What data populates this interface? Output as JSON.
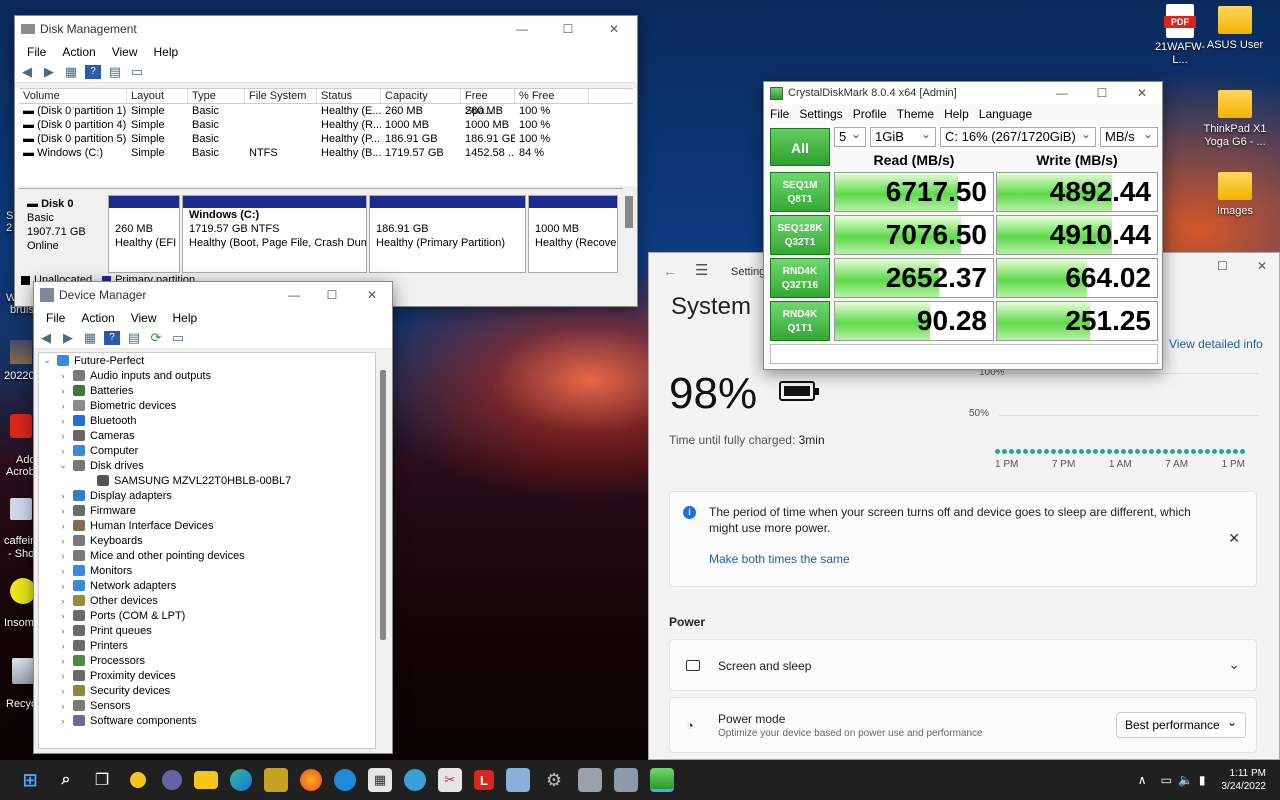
{
  "desktop": {
    "icons_right": [
      {
        "label": "21WAFW-L...",
        "icon": "pdf-icon"
      },
      {
        "label": "ASUS User",
        "icon": "folder-icon"
      },
      {
        "label": "ThinkPad X1 Yoga G6 - ...",
        "icon": "folder-icon"
      },
      {
        "label": "Images",
        "icon": "folder-icon"
      }
    ],
    "pdf_text": "PDF",
    "left_partial": [
      "S",
      "2",
      "W",
      "bruis",
      "20220",
      "Add",
      "Acrob",
      "caffein",
      "- Sho",
      "Insomn",
      "Recyc"
    ]
  },
  "disk_management": {
    "title": "Disk Management",
    "menu": [
      "File",
      "Action",
      "View",
      "Help"
    ],
    "columns": [
      "Volume",
      "Layout",
      "Type",
      "File System",
      "Status",
      "Capacity",
      "Free Spa...",
      "% Free"
    ],
    "rows": [
      [
        "(Disk 0 partition 1)",
        "Simple",
        "Basic",
        "",
        "Healthy (E...",
        "260 MB",
        "260 MB",
        "100 %"
      ],
      [
        "(Disk 0 partition 4)",
        "Simple",
        "Basic",
        "",
        "Healthy (R...",
        "1000 MB",
        "1000 MB",
        "100 %"
      ],
      [
        "(Disk 0 partition 5)",
        "Simple",
        "Basic",
        "",
        "Healthy (P...",
        "186.91 GB",
        "186.91 GB",
        "100 %"
      ],
      [
        "Windows (C:)",
        "Simple",
        "Basic",
        "NTFS",
        "Healthy (B...",
        "1719.57 GB",
        "1452.58 ...",
        "84 %"
      ]
    ],
    "disk": {
      "name": "Disk 0",
      "type": "Basic",
      "size": "1907.71 GB",
      "state": "Online"
    },
    "partitions": [
      {
        "name": "",
        "size": "260 MB",
        "status": "Healthy (EFI S"
      },
      {
        "name": "Windows  (C:)",
        "size": "1719.57 GB NTFS",
        "status": "Healthy (Boot, Page File, Crash Dump, B"
      },
      {
        "name": "",
        "size": "186.91 GB",
        "status": "Healthy (Primary Partition)"
      },
      {
        "name": "",
        "size": "1000 MB",
        "status": "Healthy (Recovery"
      }
    ],
    "legend": [
      "Unallocated",
      "Primary partition"
    ]
  },
  "device_manager": {
    "title": "Device Manager",
    "menu": [
      "File",
      "Action",
      "View",
      "Help"
    ],
    "root": "Future-Perfect",
    "items": [
      {
        "label": "Audio inputs and outputs",
        "color": "#7a7a7a"
      },
      {
        "label": "Batteries",
        "color": "#3a7a3a"
      },
      {
        "label": "Biometric devices",
        "color": "#8a8a8a"
      },
      {
        "label": "Bluetooth",
        "color": "#1e6fd9"
      },
      {
        "label": "Cameras",
        "color": "#666666"
      },
      {
        "label": "Computer",
        "color": "#3b8ad9"
      },
      {
        "label": "Disk drives",
        "color": "#777777",
        "expanded": true
      },
      {
        "label": "SAMSUNG MZVL22T0HBLB-00BL7",
        "color": "#555555",
        "child": true
      },
      {
        "label": "Display adapters",
        "color": "#2f7fc9"
      },
      {
        "label": "Firmware",
        "color": "#6a6a6a"
      },
      {
        "label": "Human Interface Devices",
        "color": "#8a6a4a"
      },
      {
        "label": "Keyboards",
        "color": "#7a7a7a"
      },
      {
        "label": "Mice and other pointing devices",
        "color": "#7a7a7a"
      },
      {
        "label": "Monitors",
        "color": "#3b8ad9"
      },
      {
        "label": "Network adapters",
        "color": "#3b8ad9"
      },
      {
        "label": "Other devices",
        "color": "#9a8a3a"
      },
      {
        "label": "Ports (COM & LPT)",
        "color": "#6a6a6a"
      },
      {
        "label": "Print queues",
        "color": "#6a6a6a"
      },
      {
        "label": "Printers",
        "color": "#6a6a6a"
      },
      {
        "label": "Processors",
        "color": "#4a8a4a"
      },
      {
        "label": "Proximity devices",
        "color": "#6a6a6a"
      },
      {
        "label": "Security devices",
        "color": "#8a8a3a"
      },
      {
        "label": "Sensors",
        "color": "#7a7a7a"
      },
      {
        "label": "Software components",
        "color": "#6a6a9a"
      }
    ]
  },
  "crystaldiskmark": {
    "title": "CrystalDiskMark 8.0.4 x64 [Admin]",
    "menu": [
      "File",
      "Settings",
      "Profile",
      "Theme",
      "Help",
      "Language"
    ],
    "count": "5",
    "size": "1GiB",
    "drive": "C: 16% (267/1720GiB)",
    "unit": "MB/s",
    "all_label": "All",
    "read_header": "Read (MB/s)",
    "write_header": "Write (MB/s)",
    "tests": [
      {
        "l1": "SEQ1M",
        "l2": "Q8T1",
        "read": "6717.50",
        "write": "4892.44",
        "read_fill": 0.78,
        "write_fill": 0.72
      },
      {
        "l1": "SEQ128K",
        "l2": "Q32T1",
        "read": "7076.50",
        "write": "4910.44",
        "read_fill": 0.8,
        "write_fill": 0.72
      },
      {
        "l1": "RND4K",
        "l2": "Q32T16",
        "read": "2652.37",
        "write": "664.02",
        "read_fill": 0.66,
        "write_fill": 0.56
      },
      {
        "l1": "RND4K",
        "l2": "Q1T1",
        "read": "90.28",
        "write": "251.25",
        "read_fill": 0.6,
        "write_fill": 0.58
      }
    ]
  },
  "settings": {
    "title": "Settings",
    "page": "System",
    "view_detailed": "View detailed info",
    "battery_pct": "98%",
    "charge_label": "Time until fully charged:",
    "charge_time": "3min",
    "chart_y": [
      "100%",
      "50%"
    ],
    "chart_x": [
      "1 PM",
      "7 PM",
      "1 AM",
      "7 AM",
      "1 PM"
    ],
    "info_text": "The period of time when your screen turns off and device goes to sleep are different, which might use more power.",
    "info_link": "Make both times the same",
    "power_heading": "Power",
    "screen_sleep": "Screen and sleep",
    "power_mode": "Power mode",
    "power_mode_desc": "Optimize your device based on power use and performance",
    "power_mode_value": "Best performance"
  },
  "taskbar": {
    "time": "1:11 PM",
    "date": "3/24/2022"
  }
}
